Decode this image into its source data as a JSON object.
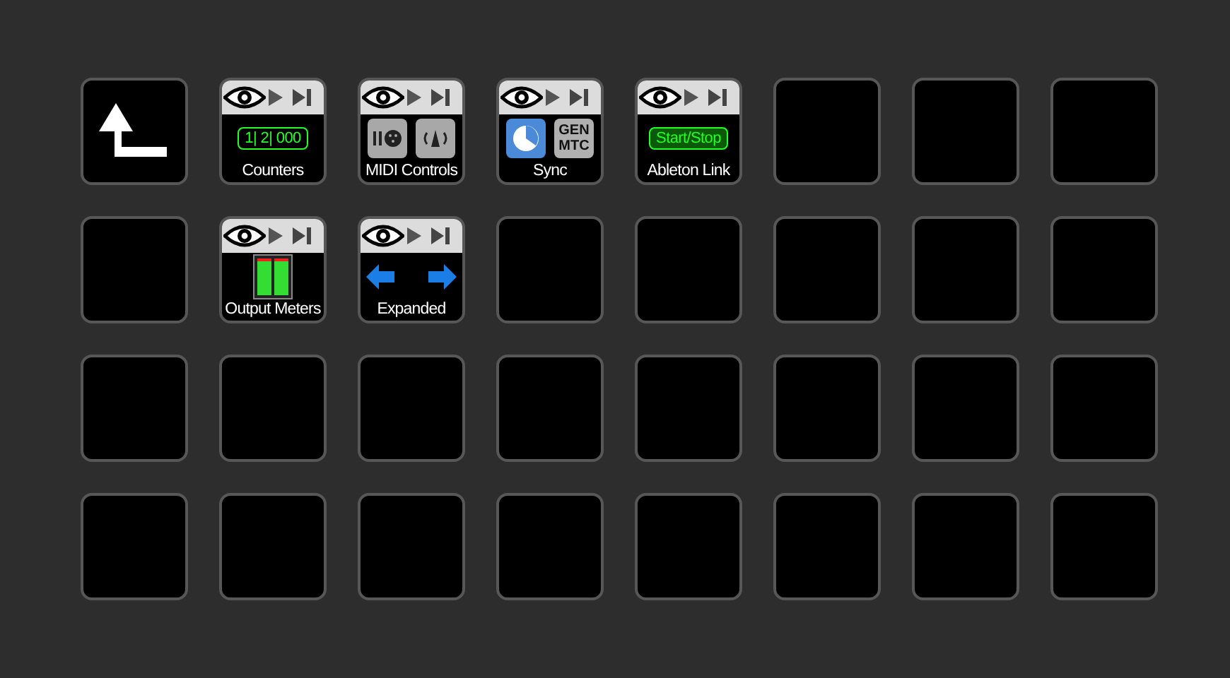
{
  "keys": [
    {
      "kind": "back"
    },
    {
      "kind": "counters",
      "label": "Counters",
      "display": "1| 2| 000"
    },
    {
      "kind": "midi",
      "label": "MIDI Controls"
    },
    {
      "kind": "sync",
      "label": "Sync",
      "badge": "GEN MTC"
    },
    {
      "kind": "link",
      "label": "Ableton Link",
      "display": "Start/Stop"
    },
    {
      "kind": "empty"
    },
    {
      "kind": "empty"
    },
    {
      "kind": "empty"
    },
    {
      "kind": "empty"
    },
    {
      "kind": "meters",
      "label": "Output Meters"
    },
    {
      "kind": "expanded",
      "label": "Expanded"
    },
    {
      "kind": "empty"
    },
    {
      "kind": "empty"
    },
    {
      "kind": "empty"
    },
    {
      "kind": "empty"
    },
    {
      "kind": "empty"
    },
    {
      "kind": "empty"
    },
    {
      "kind": "empty"
    },
    {
      "kind": "empty"
    },
    {
      "kind": "empty"
    },
    {
      "kind": "empty"
    },
    {
      "kind": "empty"
    },
    {
      "kind": "empty"
    },
    {
      "kind": "empty"
    },
    {
      "kind": "empty"
    },
    {
      "kind": "empty"
    },
    {
      "kind": "empty"
    },
    {
      "kind": "empty"
    },
    {
      "kind": "empty"
    },
    {
      "kind": "empty"
    },
    {
      "kind": "empty"
    },
    {
      "kind": "empty"
    }
  ]
}
